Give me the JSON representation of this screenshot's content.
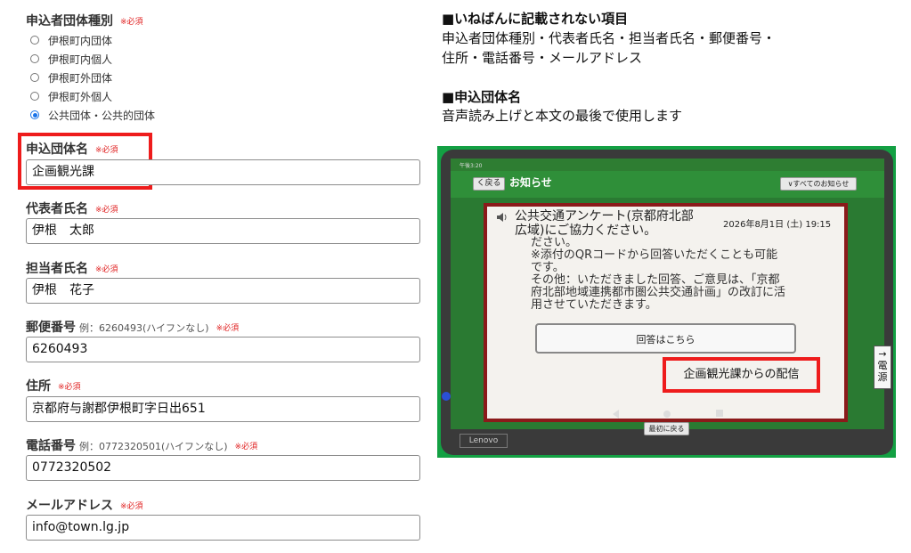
{
  "form": {
    "required_mark": "※必須",
    "org_type": {
      "label": "申込者団体種別",
      "options": [
        "伊根町内団体",
        "伊根町内個人",
        "伊根町外団体",
        "伊根町外個人",
        "公共団体・公共的団体"
      ],
      "selected_index": 4
    },
    "org_name": {
      "label": "申込団体名",
      "value": "企画観光課"
    },
    "rep_name": {
      "label": "代表者氏名",
      "value": "伊根　太郎"
    },
    "contact_name": {
      "label": "担当者氏名",
      "value": "伊根　花子"
    },
    "postal": {
      "label": "郵便番号",
      "hint": "例：6260493(ハイフンなし)",
      "value": "6260493"
    },
    "address": {
      "label": "住所",
      "value": "京都府与謝郡伊根町字日出651"
    },
    "phone": {
      "label": "電話番号",
      "hint": "例：0772320501(ハイフンなし)",
      "value": "0772320502"
    },
    "email": {
      "label": "メールアドレス",
      "value": "info@town.lg.jp"
    }
  },
  "notes": {
    "section1_title": "■いねばんに記載されない項目",
    "section1_lines": [
      "申込者団体種別・代表者氏名・担当者氏名・郵便番号・",
      "住所・電話番号・メールアドレス"
    ],
    "section2_title": "■申込団体名",
    "section2_text": "音声読み上げと本文の最後で使用します"
  },
  "tablet": {
    "status_time": "午後3:20",
    "back_button": "く戻る",
    "header_title": "お知らせ",
    "all_notices_button": "∨すべてのお知らせ",
    "notice_title_lines": [
      "公共交通アンケート(京都府北部",
      "広域)にご協力ください。"
    ],
    "notice_date": "2026年8月1日 (土) 19:15",
    "notice_body_lines": [
      "ださい。",
      "※添付のQRコードから回答いただくことも可能",
      "です。",
      "その他：いただきました回答、ご意見は、「京都",
      "府北部地域連携都市圏公共交通計画」の改訂に活",
      "用させていただきます。"
    ],
    "answer_button": "回答はこちら",
    "sender_label": "企画観光課からの配信",
    "back_to_top_button": "最初に戻る",
    "brand": "Lenovo",
    "power_arrow": "→",
    "power_label_chars": [
      "電",
      "源"
    ]
  },
  "colors": {
    "highlight_red": "#ee1c1c",
    "tablet_green": "#2f8f39",
    "card_border": "#8b1a1a"
  }
}
